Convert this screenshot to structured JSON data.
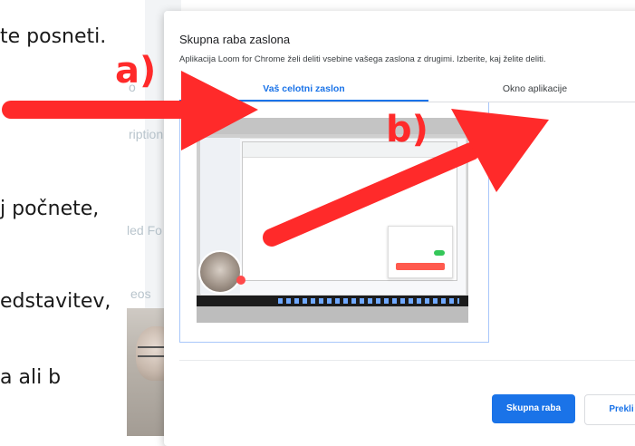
{
  "background": {
    "lines": [
      "te posneti.",
      "j počnete,",
      "edstavitev,",
      "a ali b"
    ],
    "faint": [
      "o",
      "ription",
      "led Fo",
      "eos"
    ]
  },
  "dialog": {
    "title": "Skupna raba zaslona",
    "description": "Aplikacija Loom for Chrome želi deliti vsebine vašega zaslona z drugimi. Izberite, kaj želite deliti.",
    "tabs": [
      {
        "label": "Vaš celotni zaslon",
        "active": true
      },
      {
        "label": "Okno aplikacije",
        "active": false
      }
    ],
    "share_button": "Skupna raba",
    "cancel_button": "Prekli"
  },
  "annotations": {
    "label_a": "a)",
    "label_b": "b)",
    "arrow_color": "#ff2a2a"
  },
  "colors": {
    "accent": "#1a73e8",
    "annotation": "#ff2a2a"
  }
}
